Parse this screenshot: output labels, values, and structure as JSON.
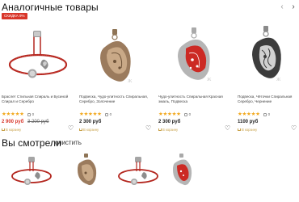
{
  "similar": {
    "title": "Аналогичные товары",
    "prev_arrow": "‹",
    "next_arrow": "›",
    "products": [
      {
        "badge": "СКИДКА 9%",
        "description": "Браслет Стильная Спираль и Бусиной Спирал и Серебро",
        "stars": "★★★★★",
        "reviews": "0",
        "price": "2 900 руб",
        "old_price": "3 200 руб",
        "cart_label": "В корзину",
        "fav_icon": "heart-outline"
      },
      {
        "badge": "",
        "description": "Подвеска, Чудо-улитность Спиральная, Серебро, Золочение",
        "stars": "★★★★★",
        "reviews": "0",
        "price": "2 300 руб",
        "old_price": "",
        "cart_label": "В корзину",
        "fav_icon": "heart-outline"
      },
      {
        "badge": "",
        "description": "Чудо-улитность Спиральная Красная эмаль, Подвеска",
        "stars": "★★★★★",
        "reviews": "0",
        "price": "2 300 руб",
        "old_price": "",
        "cart_label": "В корзину",
        "fav_icon": "heart-outline"
      },
      {
        "badge": "",
        "description": "Подвеска, Чёточки Спиральная Серебро, Чернение",
        "stars": "★★★★★",
        "reviews": "0",
        "price": "1100 руб",
        "old_price": "",
        "cart_label": "В корзину",
        "fav_icon": "heart-outline"
      }
    ]
  },
  "viewed": {
    "title": "Вы смотрели",
    "clear_label": "очистить"
  },
  "colors": {
    "accent_red": "#d8362a",
    "star_gold": "#f2a81d",
    "cart_gold": "#c8a24a"
  }
}
